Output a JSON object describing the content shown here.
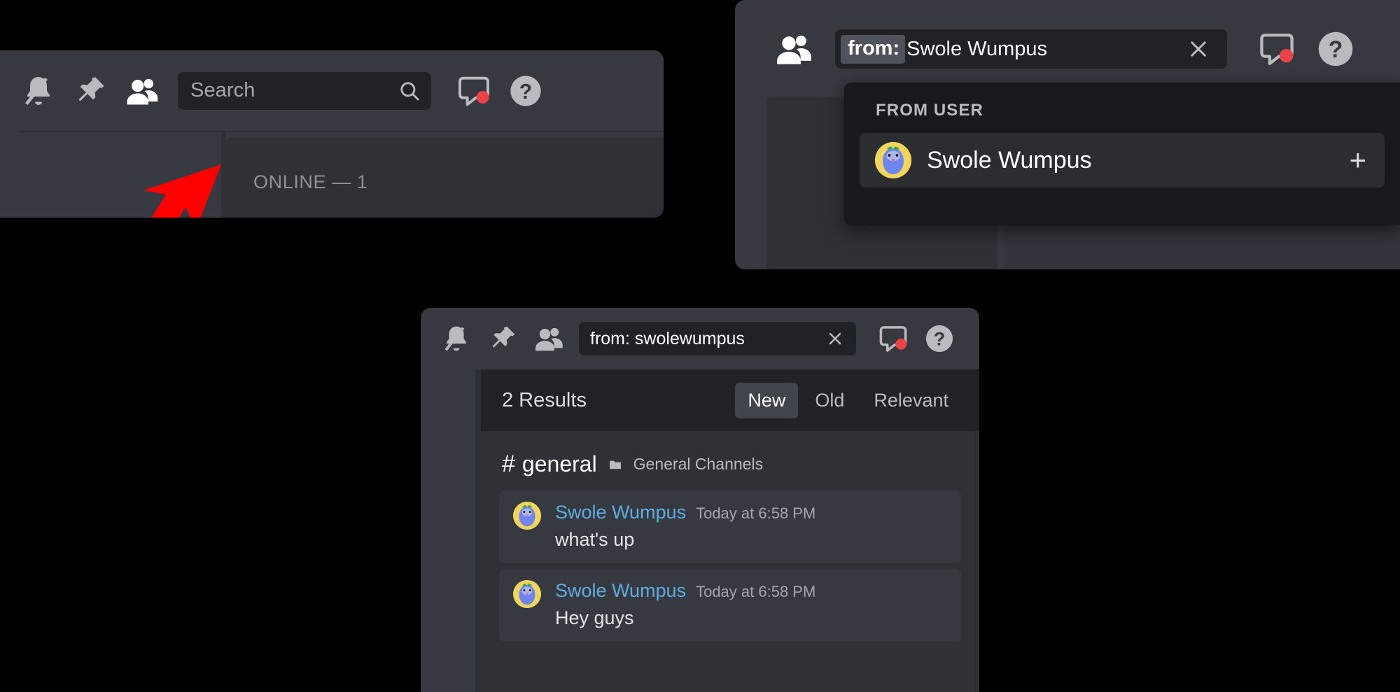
{
  "colors": {
    "panel_bg": "#36393f",
    "panel_dark": "#2f3136",
    "search_bg": "#202225",
    "dropdown_bg": "#18191c",
    "accent_link": "#5dade2",
    "muted_text": "#b9bbbe",
    "annotation_arrow": "#ff0000",
    "unread_dot": "#ed4245",
    "token_bg": "#4f545c",
    "avatar_ring": "#f2d65c",
    "avatar_body": "#5865f2"
  },
  "panel_one": {
    "name": "channel-toolbar-with-annotation",
    "icons": [
      {
        "name": "notification-muted-icon",
        "label": "Notification Settings"
      },
      {
        "name": "pin-icon",
        "label": "Pinned Messages"
      },
      {
        "name": "members-icon",
        "label": "Member List"
      }
    ],
    "search": {
      "placeholder": "Search",
      "value": "",
      "icon": "search-icon"
    },
    "right_icons": [
      {
        "name": "inbox-icon",
        "label": "Inbox",
        "has_badge": true
      },
      {
        "name": "help-icon",
        "label": "Help"
      }
    ],
    "member_list": {
      "section_label": "ONLINE — 1"
    },
    "annotation": {
      "type": "arrow",
      "points_at": "search-bar"
    }
  },
  "panel_two": {
    "name": "search-from-user-dropdown",
    "icons": [
      {
        "name": "members-icon",
        "label": "Member List"
      }
    ],
    "search": {
      "token": "from:",
      "value": "Swole Wumpus",
      "clear_label": "×"
    },
    "right_icons": [
      {
        "name": "inbox-icon",
        "label": "Inbox",
        "has_badge": true
      },
      {
        "name": "help-icon",
        "label": "Help"
      }
    ],
    "dropdown": {
      "header": "FROM USER",
      "rows": [
        {
          "name": "Swole Wumpus",
          "action": "+",
          "avatar": "wumpus-avatar"
        }
      ]
    },
    "cursor": {
      "name": "pointer-cursor"
    }
  },
  "panel_three": {
    "name": "search-results-panel",
    "icons": [
      {
        "name": "notification-muted-icon",
        "label": "Notification Settings"
      },
      {
        "name": "pin-icon",
        "label": "Pinned Messages"
      },
      {
        "name": "members-icon",
        "label": "Member List"
      }
    ],
    "search": {
      "value": "from: swolewumpus",
      "clear_label": "×"
    },
    "right_icons": [
      {
        "name": "inbox-icon",
        "label": "Inbox",
        "has_badge": true
      },
      {
        "name": "help-icon",
        "label": "Help"
      }
    ],
    "results_header": {
      "count_label": "2 Results",
      "sort_tabs": [
        {
          "label": "New",
          "active": true
        },
        {
          "label": "Old",
          "active": false
        },
        {
          "label": "Relevant",
          "active": false
        }
      ]
    },
    "channel_group": {
      "hash": "#",
      "channel": "general",
      "category_icon": "folder-icon",
      "category": "General Channels"
    },
    "messages": [
      {
        "author": "Swole Wumpus",
        "timestamp": "Today at 6:58 PM",
        "text": "what's up",
        "avatar": "wumpus-avatar"
      },
      {
        "author": "Swole Wumpus",
        "timestamp": "Today at 6:58 PM",
        "text": "Hey guys",
        "avatar": "wumpus-avatar"
      }
    ]
  }
}
